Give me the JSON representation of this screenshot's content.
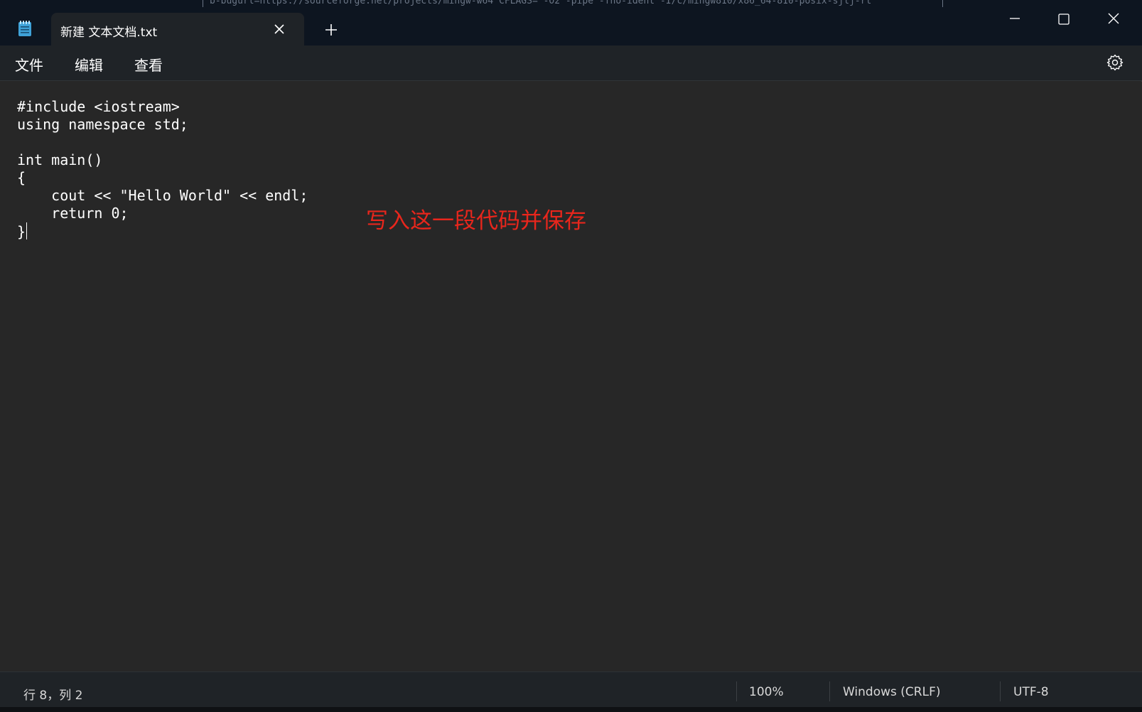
{
  "background_peek": "b-bugurl=https://sourceforge.net/projects/mingw-w64 CFLAGS='-O2 -pipe -fno-ident -I/c/mingw810/x86_64-810-posix-sjlj-rt",
  "titlebar": {
    "app_icon": "notepad-icon",
    "tab_label": "新建 文本文档.txt",
    "close_tab_icon": "close-icon",
    "new_tab_icon": "plus-icon",
    "minimize_icon": "minimize-icon",
    "maximize_icon": "maximize-icon",
    "close_window_icon": "close-icon"
  },
  "menubar": {
    "file": "文件",
    "edit": "编辑",
    "view": "查看",
    "settings_icon": "gear-icon"
  },
  "editor": {
    "lines": [
      "#include <iostream>",
      "using namespace std;",
      "",
      "int main()",
      "{",
      "    cout << \"Hello World\" << endl;",
      "    return 0;",
      "}"
    ],
    "annotation": "写入这一段代码并保存"
  },
  "statusbar": {
    "position": "行 8，列 2",
    "zoom": "100%",
    "line_ending": "Windows (CRLF)",
    "encoding": "UTF-8"
  },
  "colors": {
    "titlebar_bg": "#0d1520",
    "tab_bg": "#1f2327",
    "editor_bg": "#272727",
    "annotation_red": "#e8261c",
    "text": "#ffffff"
  }
}
